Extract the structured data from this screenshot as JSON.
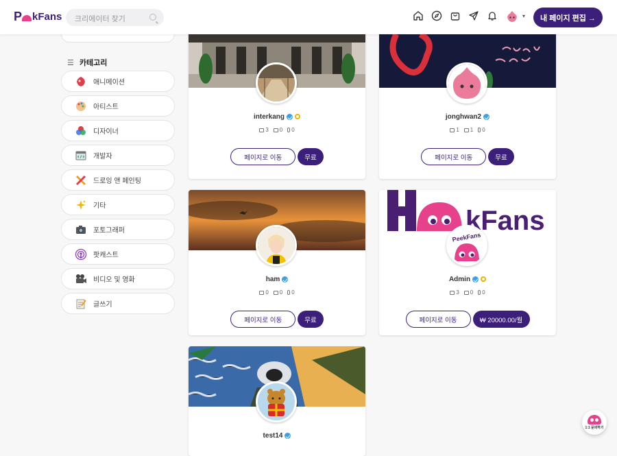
{
  "header": {
    "logo_text": "kFans",
    "logo_letter": "P",
    "search_placeholder": "크리에이터 찾기",
    "edit_button": "내 페이지 편집 →",
    "brand_color": "#3b1f7a",
    "accent_color": "#e8418c"
  },
  "sidebar": {
    "category_heading": "카테고리",
    "items": [
      {
        "label": "애니메이션",
        "icon": "animation-icon"
      },
      {
        "label": "아티스트",
        "icon": "palette-icon"
      },
      {
        "label": "디자이너",
        "icon": "design-icon"
      },
      {
        "label": "개발자",
        "icon": "code-icon"
      },
      {
        "label": "드로잉 앤 페인팅",
        "icon": "drawing-icon"
      },
      {
        "label": "기타",
        "icon": "sparkle-icon"
      },
      {
        "label": "포토그래퍼",
        "icon": "camera-icon"
      },
      {
        "label": "팟캐스트",
        "icon": "podcast-icon"
      },
      {
        "label": "비디오 및 영화",
        "icon": "video-camera-icon"
      },
      {
        "label": "글쓰기",
        "icon": "writing-icon"
      }
    ]
  },
  "cards": [
    {
      "name": "interkang",
      "images": "3",
      "videos": "0",
      "audio": "0",
      "go_label": "페이지로 이동",
      "price_label": "무료"
    },
    {
      "name": "jonghwan2",
      "images": "1",
      "videos": "1",
      "audio": "0",
      "go_label": "페이지로 이동",
      "price_label": "무료"
    },
    {
      "name": "ham",
      "images": "0",
      "videos": "0",
      "audio": "0",
      "go_label": "페이지로 이동",
      "price_label": "무료"
    },
    {
      "name": "Admin",
      "images": "3",
      "videos": "0",
      "audio": "0",
      "go_label": "페이지로 이동",
      "price_label": "₩ 20000.00/월",
      "cover_logo_text": "kFans",
      "pfp_text": "PeekFans"
    },
    {
      "name": "test14"
    }
  ],
  "chat_widget": {
    "label": "1:1 문의하기"
  }
}
